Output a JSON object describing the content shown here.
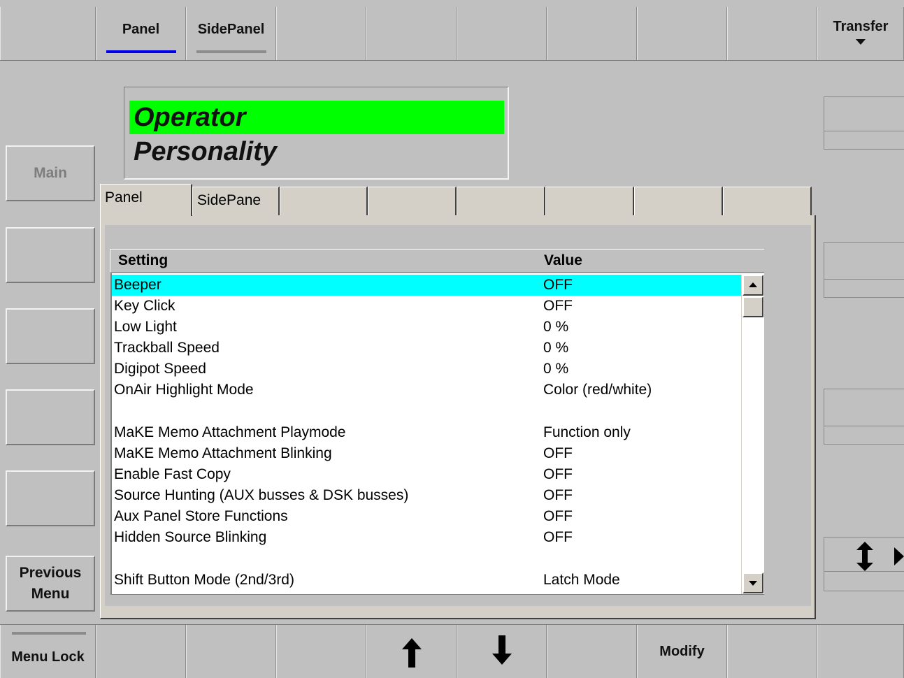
{
  "caption": "…g…(partially visible: operator personality)",
  "top_bar": {
    "tabs": [
      {
        "label": "Panel",
        "active": true
      },
      {
        "label": "SidePanel",
        "active": false
      }
    ],
    "transfer_label": "Transfer",
    "accent_active": "#0000e6",
    "accent_inactive": "#8c8c8c"
  },
  "title": {
    "line1": "Operator",
    "line2": "Personality",
    "highlight_color": "#00ff00"
  },
  "left_menu": {
    "main_label": "Main",
    "previous_menu_label": "Previous Menu"
  },
  "inner_tabs": [
    "Panel",
    "SidePane"
  ],
  "table": {
    "headers": {
      "setting": "Setting",
      "value": "Value"
    },
    "selected_color": "#00ffff",
    "rows": [
      {
        "setting": "Beeper",
        "value": "OFF",
        "selected": true
      },
      {
        "setting": "Key Click",
        "value": "OFF"
      },
      {
        "setting": "Low Light",
        "value": "0 %"
      },
      {
        "setting": "Trackball Speed",
        "value": "0 %"
      },
      {
        "setting": "Digipot Speed",
        "value": "0 %"
      },
      {
        "setting": "OnAir Highlight Mode",
        "value": "Color (red/white)"
      },
      {
        "setting": "",
        "value": ""
      },
      {
        "setting": "MaKE Memo Attachment Playmode",
        "value": "Function only"
      },
      {
        "setting": "MaKE Memo Attachment Blinking",
        "value": "OFF"
      },
      {
        "setting": "Enable Fast Copy",
        "value": "OFF"
      },
      {
        "setting": "Source Hunting (AUX busses & DSK busses)",
        "value": "OFF"
      },
      {
        "setting": "Aux Panel Store Functions",
        "value": "OFF"
      },
      {
        "setting": "Hidden Source Blinking",
        "value": "OFF"
      },
      {
        "setting": "",
        "value": ""
      },
      {
        "setting": "Shift Button Mode (2nd/3rd)",
        "value": "Latch Mode"
      }
    ]
  },
  "bottom_bar": {
    "menu_lock_label": "Menu Lock",
    "modify_label": "Modify"
  }
}
